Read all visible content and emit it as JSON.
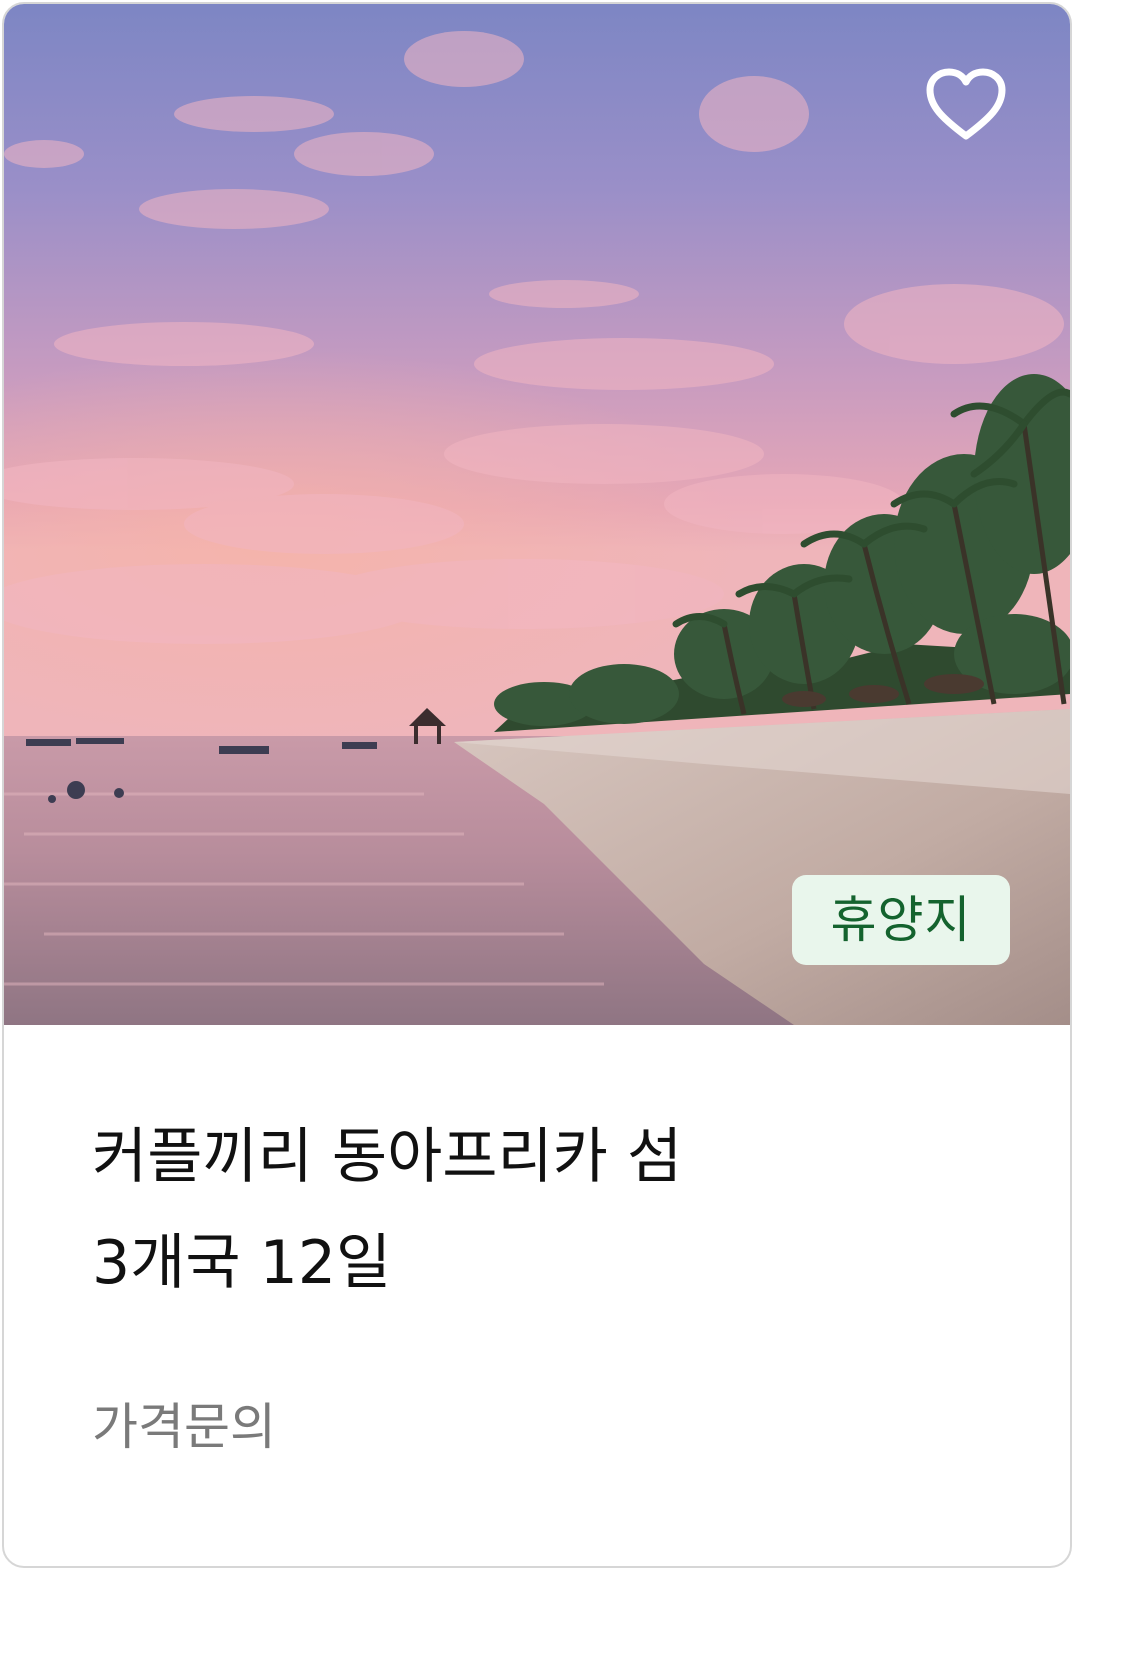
{
  "card": {
    "favorite_icon": "heart-outline-icon",
    "tag": "휴양지",
    "tag_colors": {
      "background": "#e9f6ec",
      "text": "#14632e"
    },
    "title_line1": "커플끼리 동아프리카 섬",
    "title_line2": "3개국 12일",
    "price": "가격문의",
    "image_subject": "sunset-beach-with-palm-trees"
  }
}
